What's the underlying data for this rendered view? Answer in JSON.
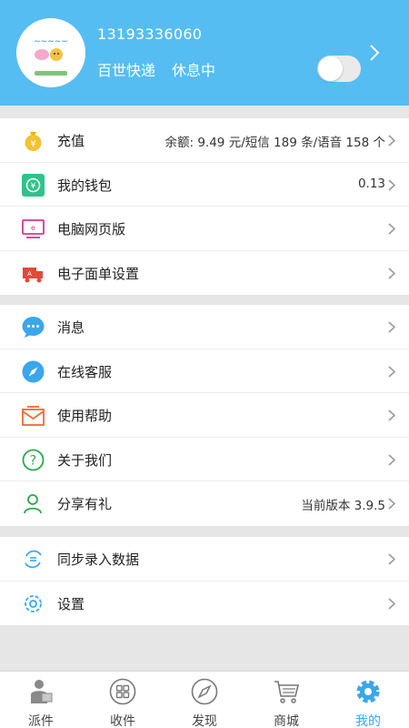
{
  "header": {
    "phone": "13193336060",
    "company": "百世快递",
    "status": "休息中",
    "rest_toggle_on": false
  },
  "menu_group_1": [
    {
      "label": "充值",
      "value": "余额: 9.49 元/短信 189 条/语音 158 个",
      "icon": "money-bag-icon"
    },
    {
      "label": "我的钱包",
      "value": "0.13",
      "icon": "wallet-icon"
    },
    {
      "label": "电脑网页版",
      "value": "",
      "icon": "monitor-icon"
    },
    {
      "label": "电子面单设置",
      "value": "",
      "icon": "waybill-truck-icon"
    }
  ],
  "menu_group_2": [
    {
      "label": "消息",
      "value": "",
      "icon": "chat-bubble-icon"
    },
    {
      "label": "在线客服",
      "value": "",
      "icon": "compass-icon"
    },
    {
      "label": "使用帮助",
      "value": "",
      "icon": "envelope-icon"
    },
    {
      "label": "关于我们",
      "value": "",
      "icon": "question-icon"
    },
    {
      "label": "分享有礼",
      "value": "当前版本 3.9.5",
      "icon": "people-icon"
    }
  ],
  "menu_group_3": [
    {
      "label": "同步录入数据",
      "value": "",
      "icon": "sync-icon"
    },
    {
      "label": "设置",
      "value": "",
      "icon": "gear-icon"
    }
  ],
  "tabbar": [
    {
      "label": "派件",
      "icon": "courier-icon",
      "active": false
    },
    {
      "label": "收件",
      "icon": "grid-icon",
      "active": false
    },
    {
      "label": "发现",
      "icon": "compass-icon",
      "active": false
    },
    {
      "label": "商城",
      "icon": "cart-icon",
      "active": false
    },
    {
      "label": "我的",
      "icon": "gear-icon",
      "active": true
    }
  ],
  "colors": {
    "header_bg": "#56bdf2",
    "active_tab": "#3aa7ec"
  }
}
